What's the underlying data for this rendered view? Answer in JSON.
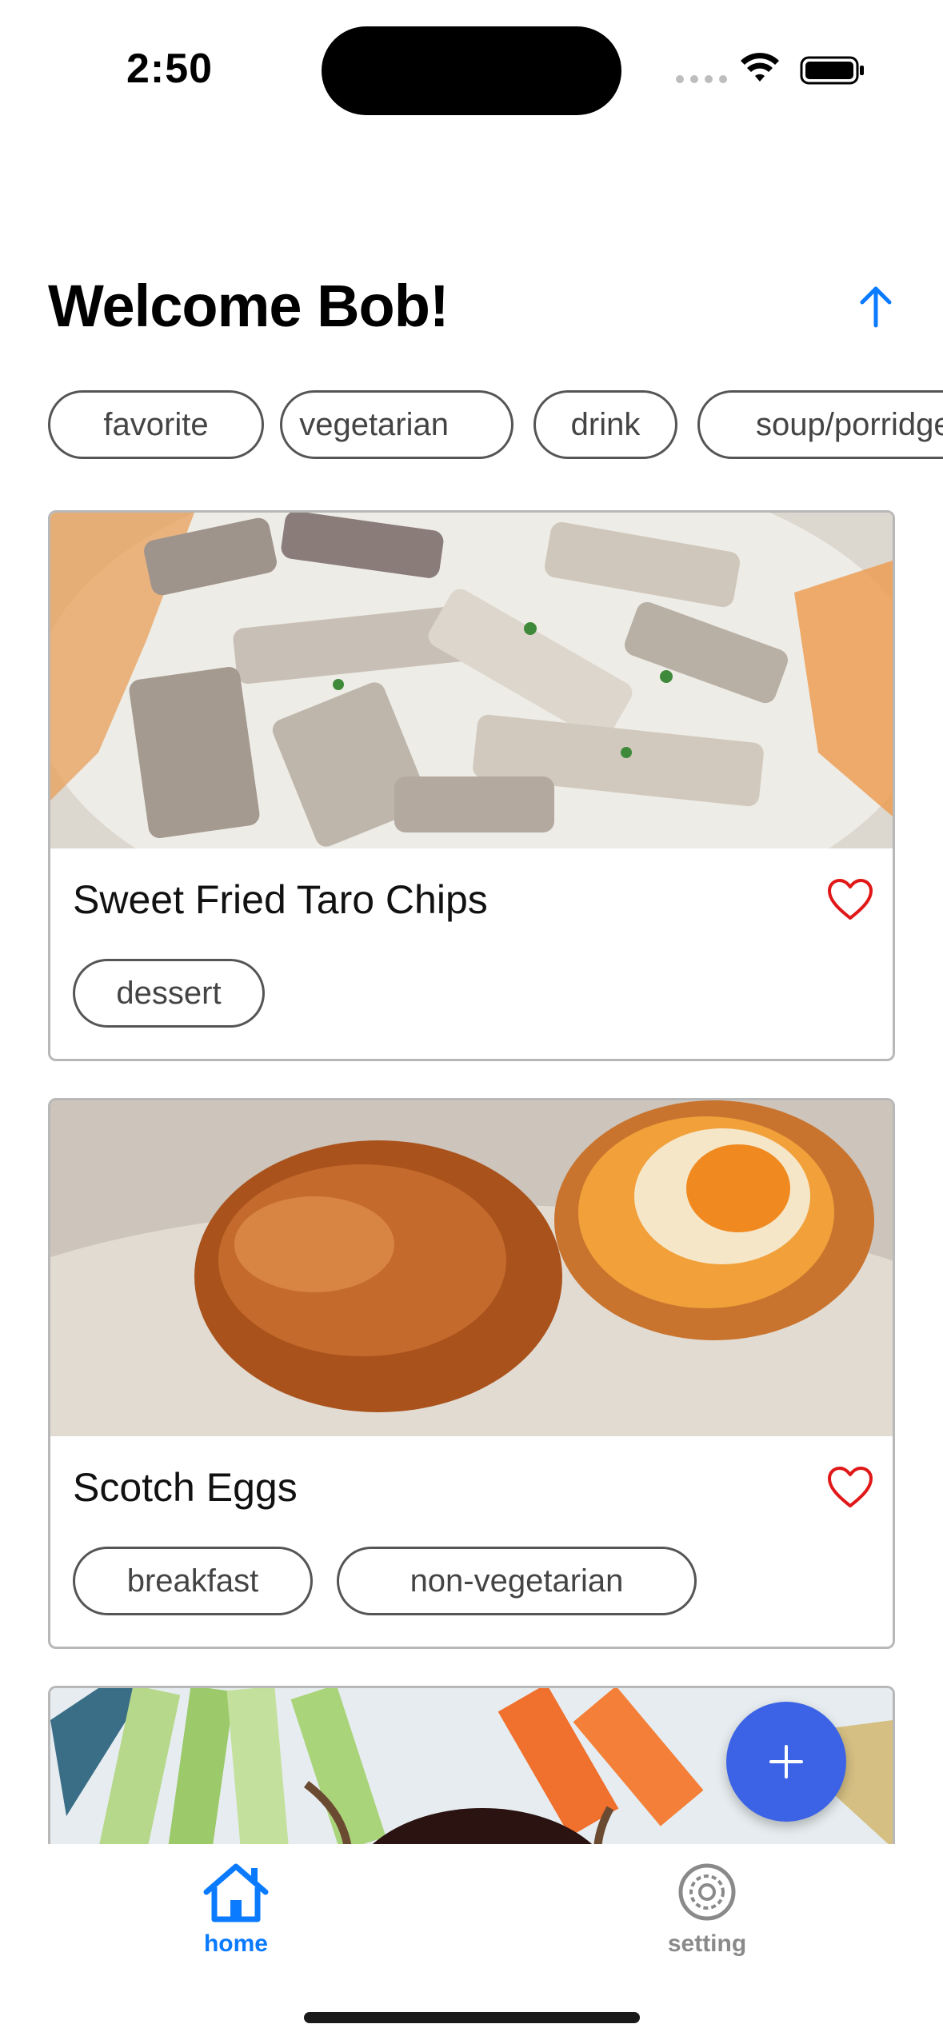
{
  "status_bar": {
    "time": "2:50"
  },
  "header": {
    "title": "Welcome Bob!"
  },
  "filters": [
    "favorite",
    "vegetarian",
    "drink",
    "soup/porridge"
  ],
  "recipes": [
    {
      "name": "Sweet Fried Taro Chips",
      "tags": [
        "dessert"
      ]
    },
    {
      "name": "Scotch Eggs",
      "tags": [
        "breakfast",
        "non-vegetarian"
      ]
    }
  ],
  "tabs": [
    {
      "label": "home",
      "icon": "house-icon",
      "active": true
    },
    {
      "label": "setting",
      "icon": "gear-icon",
      "active": false
    }
  ],
  "colors": {
    "accent": "#0a7aff",
    "fab": "#3c63e6",
    "heart": "#e01818",
    "inactive": "#8a8a8a"
  }
}
